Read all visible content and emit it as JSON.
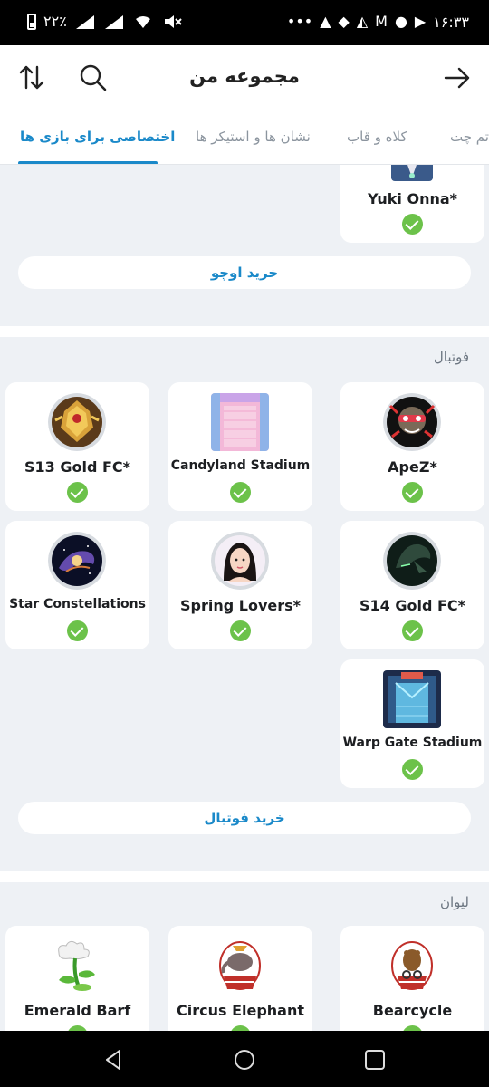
{
  "status_bar": {
    "battery": "۲۲٪",
    "time": "۱۶:۳۳"
  },
  "header": {
    "title": "مجموعه من",
    "icons": [
      "sort-icon",
      "search-icon",
      "arrow-forward-icon"
    ]
  },
  "tabs": [
    {
      "label": "اختصاصی برای بازی ها",
      "active": true
    },
    {
      "label": "نشان ها و استیکر ها",
      "active": false
    },
    {
      "label": "کلاه و قاب",
      "active": false
    },
    {
      "label": "تم چت",
      "active": false
    }
  ],
  "sections": {
    "ocho": {
      "items": [
        {
          "name": "Yuki Onna*"
        }
      ],
      "buy_label": "خرید اوچو"
    },
    "football": {
      "title": "فوتبال",
      "items": [
        {
          "name": "ApeZ*"
        },
        {
          "name": "Candyland Stadium"
        },
        {
          "name": "S13 Gold FC*"
        },
        {
          "name": "S14 Gold FC*"
        },
        {
          "name": "Spring Lovers*"
        },
        {
          "name": "Star Constellations"
        },
        {
          "name": "Warp Gate Stadium"
        }
      ],
      "buy_label": "خرید فوتبال"
    },
    "cup": {
      "title": "لیوان",
      "items": [
        {
          "name": "Bearcycle"
        },
        {
          "name": "Circus Elephant"
        },
        {
          "name": "Emerald Barf"
        }
      ]
    }
  },
  "colors": {
    "accent": "#1a89c9",
    "check": "#6cc24a",
    "background": "#eef1f5"
  }
}
